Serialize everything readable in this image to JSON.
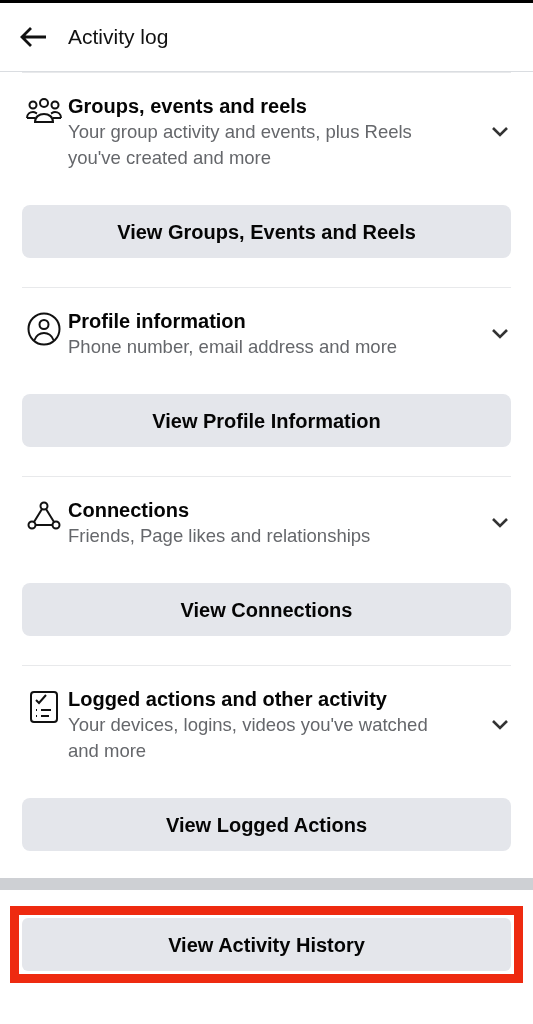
{
  "header": {
    "title": "Activity log"
  },
  "sections": [
    {
      "kind": "groups",
      "title": "Groups, events and reels",
      "subtitle": "Your group activity and events, plus Reels you've created and more",
      "expanded": false,
      "button": "View Groups, Events and Reels"
    },
    {
      "kind": "profile",
      "title": "Profile information",
      "subtitle": "Phone number, email address and more",
      "expanded": false,
      "button": "View Profile Information"
    },
    {
      "kind": "connections",
      "title": "Connections",
      "subtitle": "Friends, Page likes and relationships",
      "expanded": false,
      "button": "View Connections"
    },
    {
      "kind": "logged",
      "title": "Logged actions and other activity",
      "subtitle": "Your devices, logins, videos you've watched and more",
      "expanded": false,
      "button": "View Logged Actions"
    }
  ],
  "footer_button": {
    "label": "View Activity History",
    "highlighted": true
  }
}
